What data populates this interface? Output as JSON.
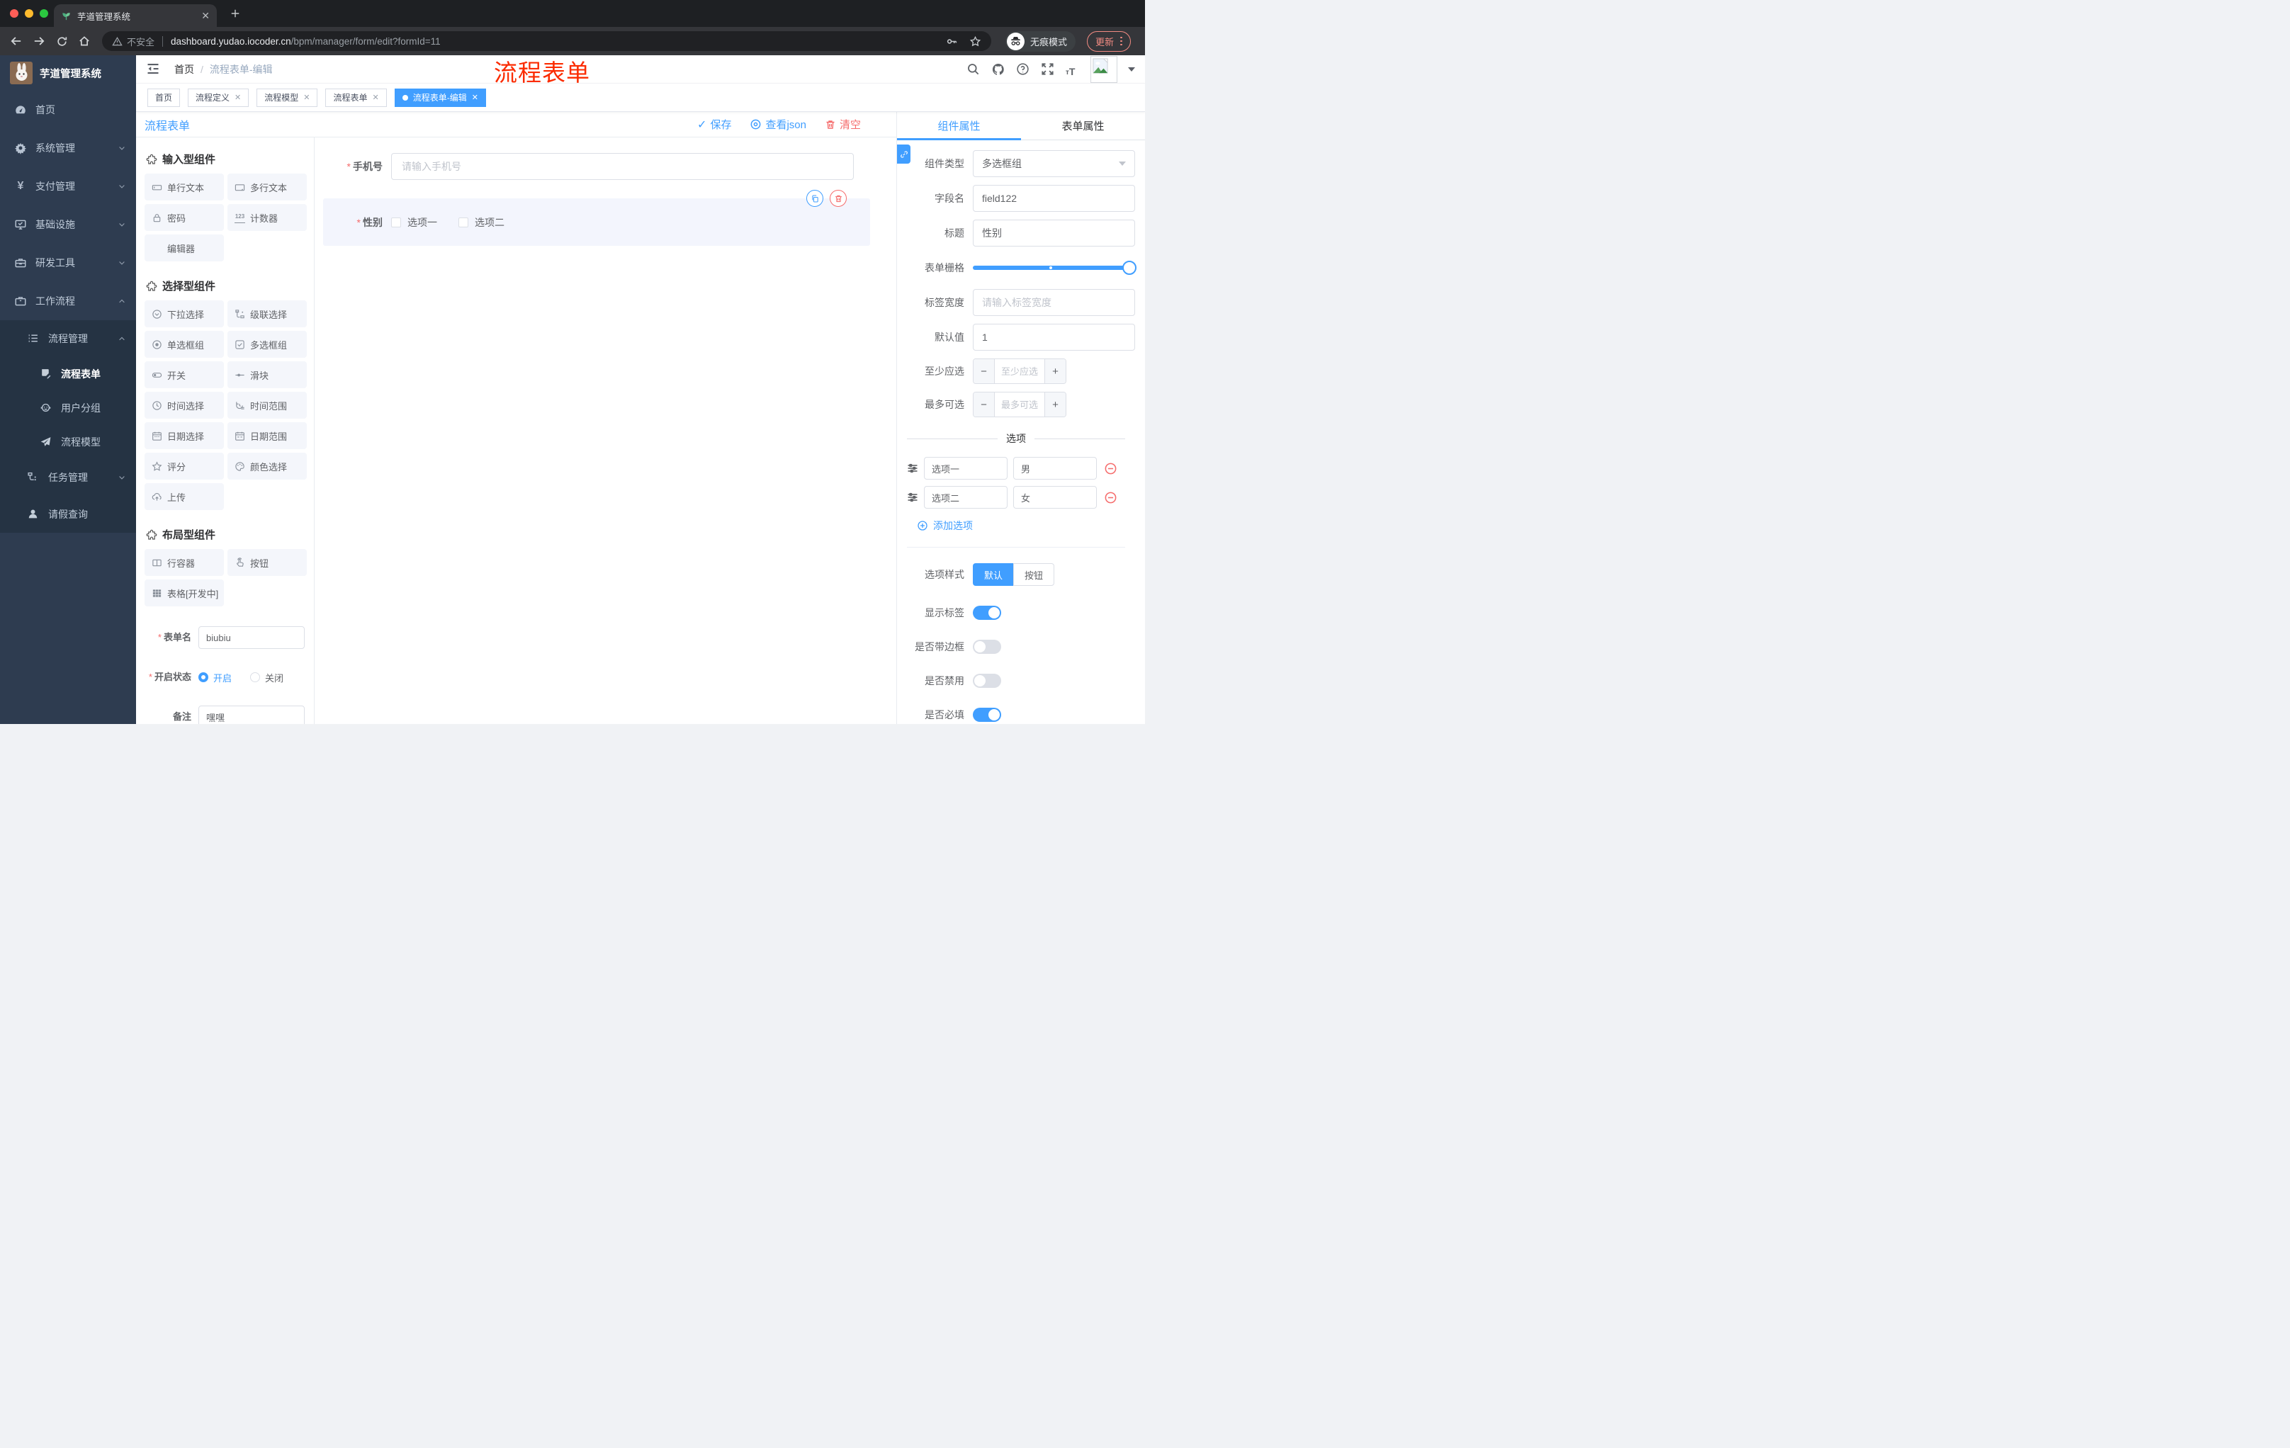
{
  "browser": {
    "tab_title": "芋道管理系统",
    "security_label": "不安全",
    "url_host": "dashboard.yudao.iocoder.cn",
    "url_path": "/bpm/manager/form/edit?formId=11",
    "incognito_label": "无痕模式",
    "update_label": "更新"
  },
  "sidebar": {
    "logo_title": "芋道管理系统",
    "items": [
      {
        "label": "首页"
      },
      {
        "label": "系统管理"
      },
      {
        "label": "支付管理"
      },
      {
        "label": "基础设施"
      },
      {
        "label": "研发工具"
      },
      {
        "label": "工作流程"
      },
      {
        "label": "流程管理"
      },
      {
        "label": "流程表单"
      },
      {
        "label": "用户分组"
      },
      {
        "label": "流程模型"
      },
      {
        "label": "任务管理"
      },
      {
        "label": "请假查询"
      }
    ]
  },
  "header": {
    "breadcrumb_home": "首页",
    "breadcrumb_current": "流程表单-编辑",
    "annotation": "流程表单"
  },
  "tags": [
    "首页",
    "流程定义",
    "流程模型",
    "流程表单",
    "流程表单-编辑"
  ],
  "toolbar": {
    "title": "流程表单",
    "save": "保存",
    "view_json": "查看json",
    "clear": "清空"
  },
  "palette": {
    "sections": [
      {
        "title": "输入型组件",
        "items": [
          "单行文本",
          "多行文本",
          "密码",
          "计数器",
          "编辑器"
        ]
      },
      {
        "title": "选择型组件",
        "items": [
          "下拉选择",
          "级联选择",
          "单选框组",
          "多选框组",
          "开关",
          "滑块",
          "时间选择",
          "时间范围",
          "日期选择",
          "日期范围",
          "评分",
          "颜色选择",
          "上传"
        ]
      },
      {
        "title": "布局型组件",
        "items": [
          "行容器",
          "按钮",
          "表格[开发中]"
        ]
      }
    ]
  },
  "meta": {
    "name_label": "表单名",
    "name_value": "biubiu",
    "status_label": "开启状态",
    "on_label": "开启",
    "off_label": "关闭",
    "status_selected": "开启",
    "remark_label": "备注",
    "remark_value": "嘿嘿"
  },
  "canvas": {
    "phone_label": "手机号",
    "phone_placeholder": "请输入手机号",
    "phone_required": true,
    "gender_label": "性别",
    "gender_required": true,
    "gender_options": [
      "选项一",
      "选项二"
    ]
  },
  "panel": {
    "tab_component": "组件属性",
    "tab_form": "表单属性",
    "active_tab": "组件属性",
    "component_type_label": "组件类型",
    "component_type_value": "多选框组",
    "field_name_label": "字段名",
    "field_name_value": "field122",
    "title_label": "标题",
    "title_value": "性别",
    "grid_label": "表单栅格",
    "grid_value_percent": 100,
    "label_width_label": "标签宽度",
    "label_width_placeholder": "请输入标签宽度",
    "default_label": "默认值",
    "default_value": "1",
    "min_label": "至少应选",
    "min_placeholder": "至少应选",
    "max_label": "最多可选",
    "max_placeholder": "最多可选",
    "options_divider": "选项",
    "options": [
      {
        "name": "选项一",
        "value": "男"
      },
      {
        "name": "选项二",
        "value": "女"
      }
    ],
    "add_option": "添加选项",
    "style_label": "选项样式",
    "style_default": "默认",
    "style_button": "按钮",
    "style_selected": "默认",
    "toggles": [
      {
        "label": "显示标签",
        "on": true
      },
      {
        "label": "是否带边框",
        "on": false
      },
      {
        "label": "是否禁用",
        "on": false
      },
      {
        "label": "是否必填",
        "on": true
      }
    ],
    "colors": {
      "accent": "#409eff",
      "danger": "#f56c6c"
    }
  }
}
